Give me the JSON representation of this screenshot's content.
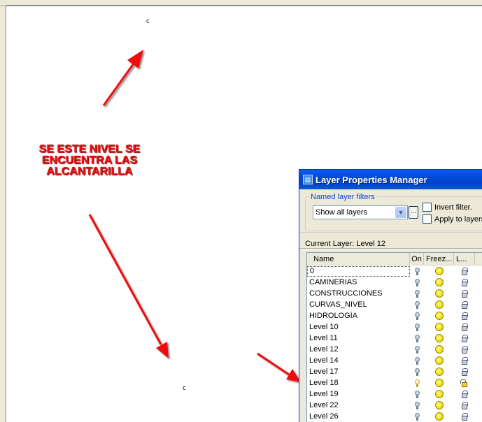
{
  "annotation": {
    "lines": [
      "SE ESTE NIVEL SE",
      "ENCUENTRA LAS",
      "ALCANTARILLA"
    ],
    "color": "#ee1111"
  },
  "drawing": {
    "markers": [
      "c",
      "c"
    ]
  },
  "dialog": {
    "title": "Layer Properties Manager",
    "filters_group_label": "Named layer filters",
    "filter_selected": "Show all layers",
    "filter_browse_label": "...",
    "invert_filter_label": "Invert filter.",
    "apply_to_layers_label": "Apply to layers",
    "current_layer_label": "Current Layer:",
    "current_layer_value": "Level 12",
    "columns": [
      "Name",
      "On",
      "Freez...",
      "L..."
    ],
    "layers": [
      {
        "name": "0",
        "on": false,
        "locked": true
      },
      {
        "name": "CAMINERIAS",
        "on": false,
        "locked": true
      },
      {
        "name": "CONSTRUCCIONES",
        "on": false,
        "locked": true
      },
      {
        "name": "CURVAS_NIVEL",
        "on": false,
        "locked": true
      },
      {
        "name": "HIDROLOGÍA",
        "on": false,
        "locked": true
      },
      {
        "name": "Level 10",
        "on": false,
        "locked": true
      },
      {
        "name": "Level 11",
        "on": false,
        "locked": true
      },
      {
        "name": "Level 12",
        "on": false,
        "locked": true
      },
      {
        "name": "Level 14",
        "on": false,
        "locked": true
      },
      {
        "name": "Level 17",
        "on": false,
        "locked": true
      },
      {
        "name": "Level 18",
        "on": true,
        "locked": false
      },
      {
        "name": "Level 19",
        "on": false,
        "locked": true
      },
      {
        "name": "Level 22",
        "on": false,
        "locked": true
      },
      {
        "name": "Level 26",
        "on": false,
        "locked": true
      }
    ]
  },
  "colors": {
    "titlebar": "#0349d6",
    "dialog_bg": "#ece9d8",
    "arrow": "#ee1111"
  }
}
